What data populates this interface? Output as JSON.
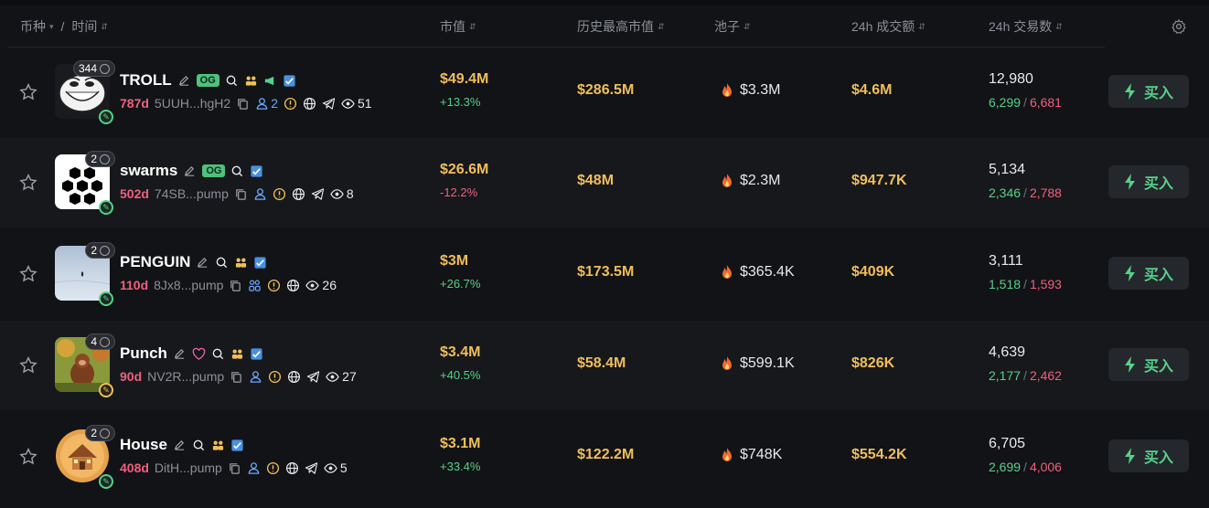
{
  "header": {
    "coin": "币种",
    "sep": "/",
    "time": "时间",
    "mcap": "市值",
    "ath": "历史最高市值",
    "pool": "池子",
    "vol": "24h 成交额",
    "txns": "24h 交易数"
  },
  "buy_label": "买入",
  "colors": {
    "accent_green": "#56d18a",
    "price_gold": "#f0be5c",
    "age_red": "#f0607f",
    "holder_blue": "#6aa8ff"
  },
  "rows": [
    {
      "badge": "344",
      "name": "TROLL",
      "og": "OG",
      "age": "787d",
      "addr": "5UUH...hgH2",
      "holders": "2",
      "views": "51",
      "mcap": "$49.4M",
      "change": "+13.3%",
      "ath": "$286.5M",
      "pool": "$3.3M",
      "vol": "$4.6M",
      "txns": "12,980",
      "buys": "6,299",
      "sells": "6,681"
    },
    {
      "badge": "2",
      "name": "swarms",
      "og": "OG",
      "age": "502d",
      "addr": "74SB...pump",
      "views": "8",
      "mcap": "$26.6M",
      "change": "-12.2%",
      "ath": "$48M",
      "pool": "$2.3M",
      "vol": "$947.7K",
      "txns": "5,134",
      "buys": "2,346",
      "sells": "2,788"
    },
    {
      "badge": "2",
      "name": "PENGUIN",
      "age": "110d",
      "addr": "8Jx8...pump",
      "views": "26",
      "mcap": "$3M",
      "change": "+26.7%",
      "ath": "$173.5M",
      "pool": "$365.4K",
      "vol": "$409K",
      "txns": "3,111",
      "buys": "1,518",
      "sells": "1,593"
    },
    {
      "badge": "4",
      "name": "Punch",
      "age": "90d",
      "addr": "NV2R...pump",
      "views": "27",
      "mcap": "$3.4M",
      "change": "+40.5%",
      "ath": "$58.4M",
      "pool": "$599.1K",
      "vol": "$826K",
      "txns": "4,639",
      "buys": "2,177",
      "sells": "2,462"
    },
    {
      "badge": "2",
      "name": "House",
      "age": "408d",
      "addr": "DitH...pump",
      "views": "5",
      "mcap": "$3.1M",
      "change": "+33.4%",
      "ath": "$122.2M",
      "pool": "$748K",
      "vol": "$554.2K",
      "txns": "6,705",
      "buys": "2,699",
      "sells": "4,006"
    }
  ]
}
